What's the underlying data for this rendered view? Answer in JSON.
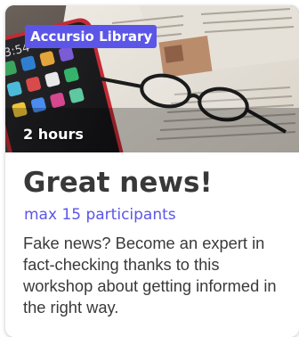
{
  "card": {
    "badge": "Accursio Library",
    "duration": "2 hours",
    "title": "Great news!",
    "participants": "max 15 participants",
    "description": "Fake news? Become an expert in fact-checking thanks to this workshop about getting informed in the right way."
  },
  "colors": {
    "accent": "#5b56e8",
    "title": "#383838",
    "text": "#3a3a3a"
  }
}
